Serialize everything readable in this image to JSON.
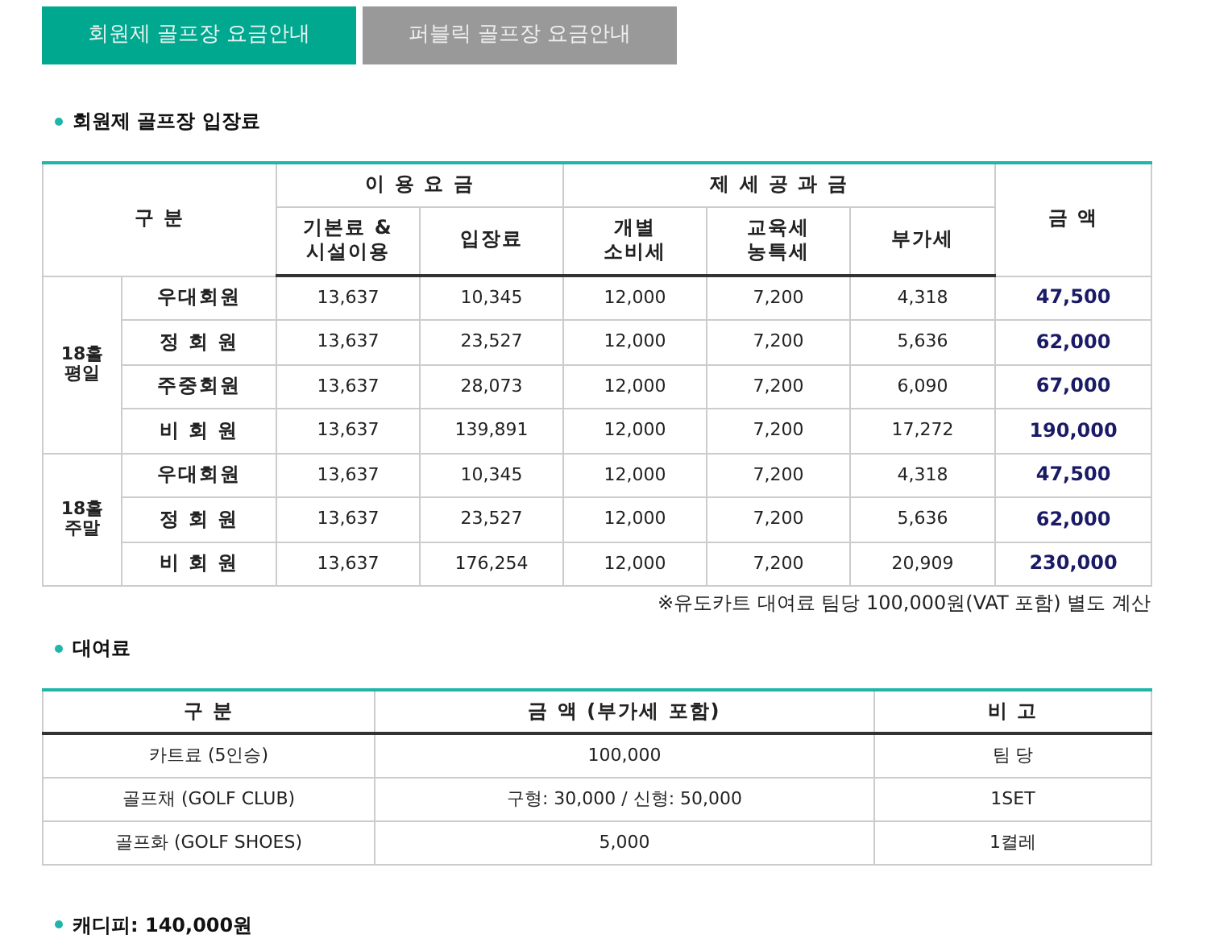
{
  "tabs": [
    {
      "label": "회원제 골프장 요금안내",
      "selected": true
    },
    {
      "label": "퍼블릭 골프장 요금안내",
      "selected": false
    }
  ],
  "fee_section": {
    "title": "회원제 골프장 입장료",
    "table": {
      "header_top": [
        "구 분",
        "이 용 요 금",
        "제 세 공 과 금",
        "금 액"
      ],
      "header_sub": [
        "기본료 &\n시설이용",
        "입장료",
        "개별\n소비세",
        "교육세\n농특세",
        "부가세"
      ],
      "groups": [
        {
          "label": "18홀\n평일",
          "rows": [
            {
              "member": "우대회원",
              "cells": [
                "13,637",
                "10,345",
                "12,000",
                "7,200",
                "4,318"
              ],
              "total": "47,500"
            },
            {
              "member": "정 회 원",
              "cells": [
                "13,637",
                "23,527",
                "12,000",
                "7,200",
                "5,636"
              ],
              "total": "62,000"
            },
            {
              "member": "주중회원",
              "cells": [
                "13,637",
                "28,073",
                "12,000",
                "7,200",
                "6,090"
              ],
              "total": "67,000"
            },
            {
              "member": "비 회 원",
              "cells": [
                "13,637",
                "139,891",
                "12,000",
                "7,200",
                "17,272"
              ],
              "total": "190,000"
            }
          ]
        },
        {
          "label": "18홀\n주말",
          "rows": [
            {
              "member": "우대회원",
              "cells": [
                "13,637",
                "10,345",
                "12,000",
                "7,200",
                "4,318"
              ],
              "total": "47,500"
            },
            {
              "member": "정 회 원",
              "cells": [
                "13,637",
                "23,527",
                "12,000",
                "7,200",
                "5,636"
              ],
              "total": "62,000"
            },
            {
              "member": "비 회 원",
              "cells": [
                "13,637",
                "176,254",
                "12,000",
                "7,200",
                "20,909"
              ],
              "total": "230,000"
            }
          ]
        }
      ]
    },
    "note": "※유도카트 대여료 팀당 100,000원(VAT 포함) 별도 계산"
  },
  "rental_section": {
    "title": "대여료",
    "table": {
      "columns": [
        "구 분",
        "금 액 (부가세 포함)",
        "비 고"
      ],
      "rows": [
        [
          "카트료 (5인승)",
          "100,000",
          "팀 당"
        ],
        [
          "골프채 (GOLF CLUB)",
          "구형: 30,000 / 신형: 50,000",
          "1SET"
        ],
        [
          "골프화 (GOLF SHOES)",
          "5,000",
          "1켤레"
        ]
      ]
    }
  },
  "caddy_fee": "캐디피: 140,000원"
}
